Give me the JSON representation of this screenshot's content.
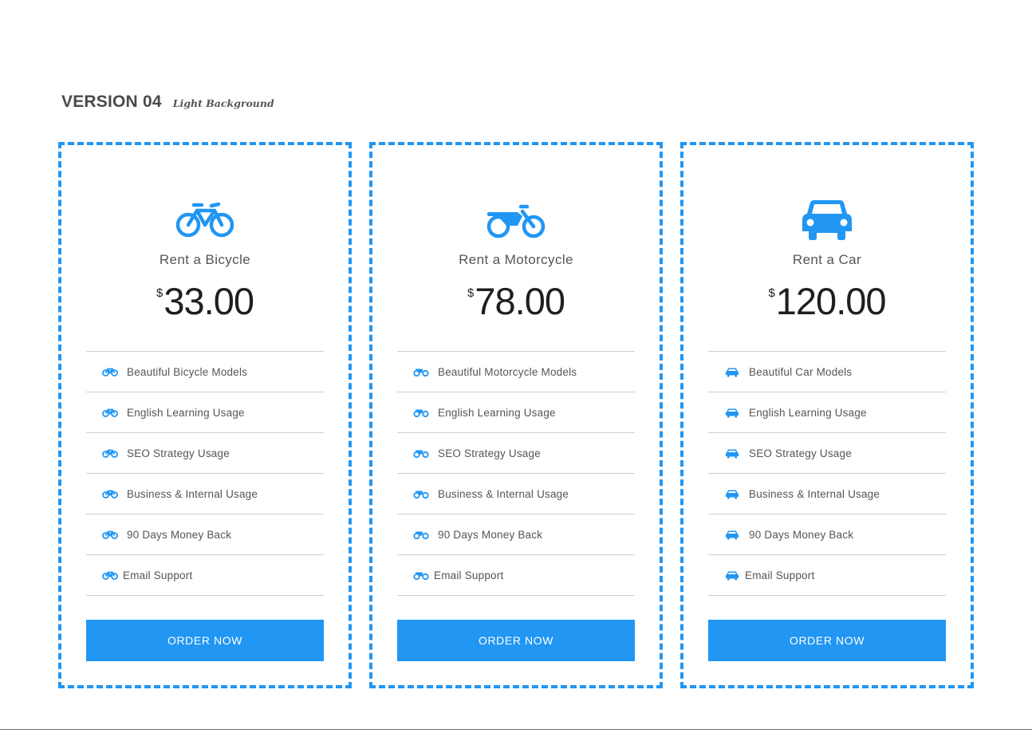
{
  "heading": {
    "version": "VERSION 04",
    "subtitle": "Light Background"
  },
  "colors": {
    "accent": "#2196f3",
    "text": "#555555",
    "divider": "#cfcfcf"
  },
  "cards": [
    {
      "icon": "bicycle-icon",
      "title": "Rent a Bicycle",
      "currency": "$",
      "price": "33.00",
      "features": [
        "Beautiful Bicycle Models",
        "English Learning Usage",
        "SEO Strategy Usage",
        "Business & Internal Usage",
        "90 Days Money Back",
        "Email Support"
      ],
      "button": "ORDER NOW"
    },
    {
      "icon": "motorcycle-icon",
      "title": "Rent a Motorcycle",
      "currency": "$",
      "price": "78.00",
      "features": [
        "Beautiful Motorcycle Models",
        "English Learning Usage",
        "SEO Strategy Usage",
        "Business & Internal Usage",
        "90 Days Money Back",
        "Email Support"
      ],
      "button": "ORDER NOW"
    },
    {
      "icon": "car-icon",
      "title": "Rent a Car",
      "currency": "$",
      "price": "120.00",
      "features": [
        "Beautiful Car Models",
        "English Learning Usage",
        "SEO Strategy Usage",
        "Business & Internal Usage",
        "90 Days Money Back",
        "Email Support"
      ],
      "button": "ORDER NOW"
    }
  ]
}
